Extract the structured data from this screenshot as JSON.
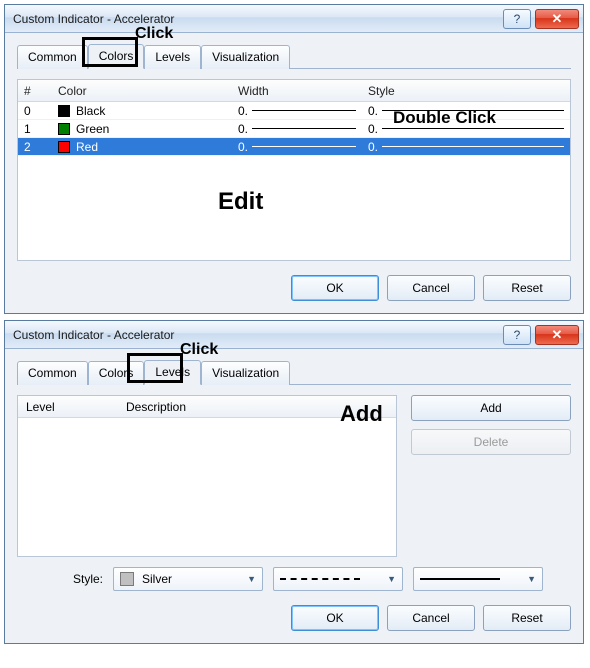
{
  "dialog1": {
    "title": "Custom Indicator - Accelerator",
    "tabs": [
      "Common",
      "Colors",
      "Levels",
      "Visualization"
    ],
    "active_tab_index": 1,
    "columns": {
      "idx": "#",
      "color": "Color",
      "width": "Width",
      "style": "Style"
    },
    "rows": [
      {
        "idx": "0",
        "color_name": "Black",
        "swatch": "#000000",
        "width_label": "0.",
        "style_label": "0.",
        "selected": false
      },
      {
        "idx": "1",
        "color_name": "Green",
        "swatch": "#008000",
        "width_label": "0.",
        "style_label": "0.",
        "selected": false
      },
      {
        "idx": "2",
        "color_name": "Red",
        "swatch": "#ff0000",
        "width_label": "0.",
        "style_label": "0.",
        "selected": true
      }
    ],
    "buttons": {
      "ok": "OK",
      "cancel": "Cancel",
      "reset": "Reset"
    }
  },
  "dialog2": {
    "title": "Custom Indicator - Accelerator",
    "tabs": [
      "Common",
      "Colors",
      "Levels",
      "Visualization"
    ],
    "active_tab_index": 2,
    "columns": {
      "level": "Level",
      "description": "Description"
    },
    "side": {
      "add": "Add",
      "delete": "Delete"
    },
    "style_label": "Style:",
    "style_color_name": "Silver",
    "style_color_hex": "#c0c0c0",
    "buttons": {
      "ok": "OK",
      "cancel": "Cancel",
      "reset": "Reset"
    }
  },
  "annotations": {
    "click1": "Click",
    "double_click": "Double Click",
    "edit": "Edit",
    "click2": "Click",
    "add": "Add"
  },
  "glyphs": {
    "help": "?",
    "close": "✕",
    "dropdown": "▼"
  }
}
